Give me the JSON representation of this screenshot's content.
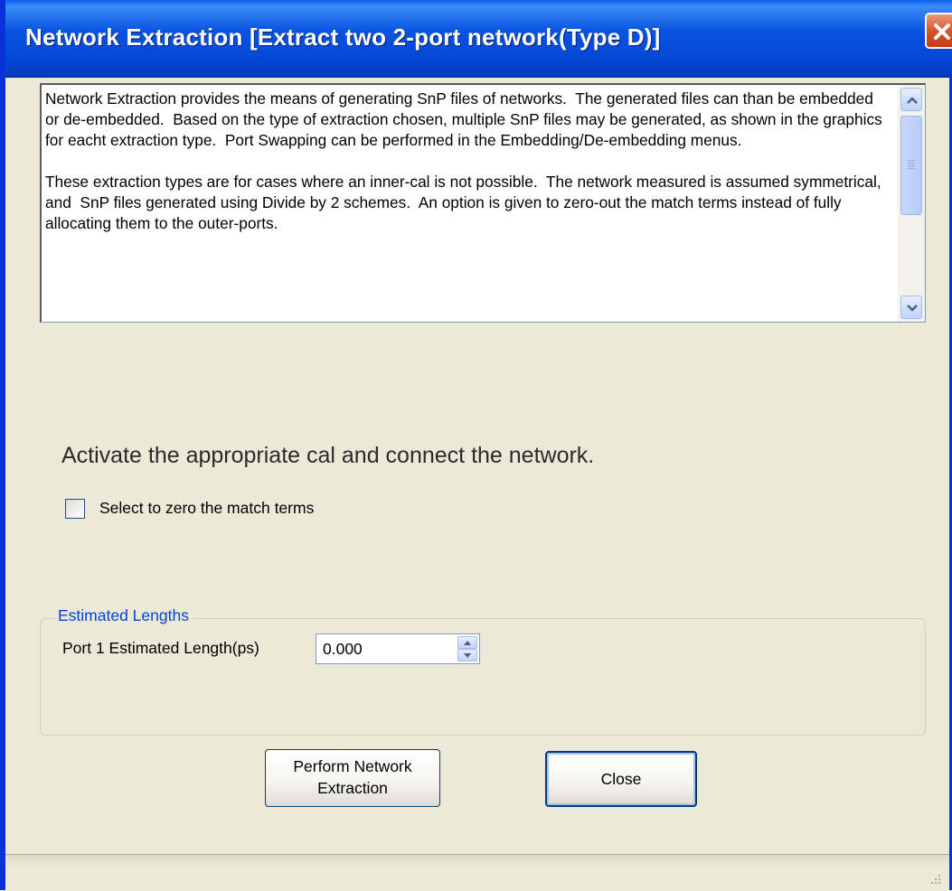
{
  "window": {
    "title": "Network Extraction [Extract two 2-port network(Type D)]"
  },
  "description": {
    "text": "Network Extraction provides the means of generating SnP files of networks.  The generated files can than be embedded or de-embedded.  Based on the type of extraction chosen, multiple SnP files may be generated, as shown in the graphics for eacht extraction type.  Port Swapping can be performed in the Embedding/De-embedding menus.\n\nThese extraction types are for cases where an inner-cal is not possible.  The network measured is assumed symmetrical, and  SnP files generated using Divide by 2 schemes.  An option is given to zero-out the match terms instead of fully allocating them to the outer-ports."
  },
  "instruction": "Activate the appropriate cal and connect the network.",
  "zero_match_checkbox": {
    "label": "Select to zero the match terms",
    "checked": false
  },
  "estimated_lengths": {
    "legend": "Estimated Lengths",
    "port1_label": "Port 1 Estimated Length(ps)",
    "port1_value": "0.000"
  },
  "buttons": {
    "perform_label": "Perform Network\nExtraction",
    "close_label": "Close"
  },
  "icons": {
    "close": "close-x-icon",
    "scroll_up": "chevron-up-icon",
    "scroll_down": "chevron-down-icon",
    "spin_up": "triangle-up-icon",
    "spin_down": "triangle-down-icon",
    "resize_grip": "resize-grip-icon"
  }
}
